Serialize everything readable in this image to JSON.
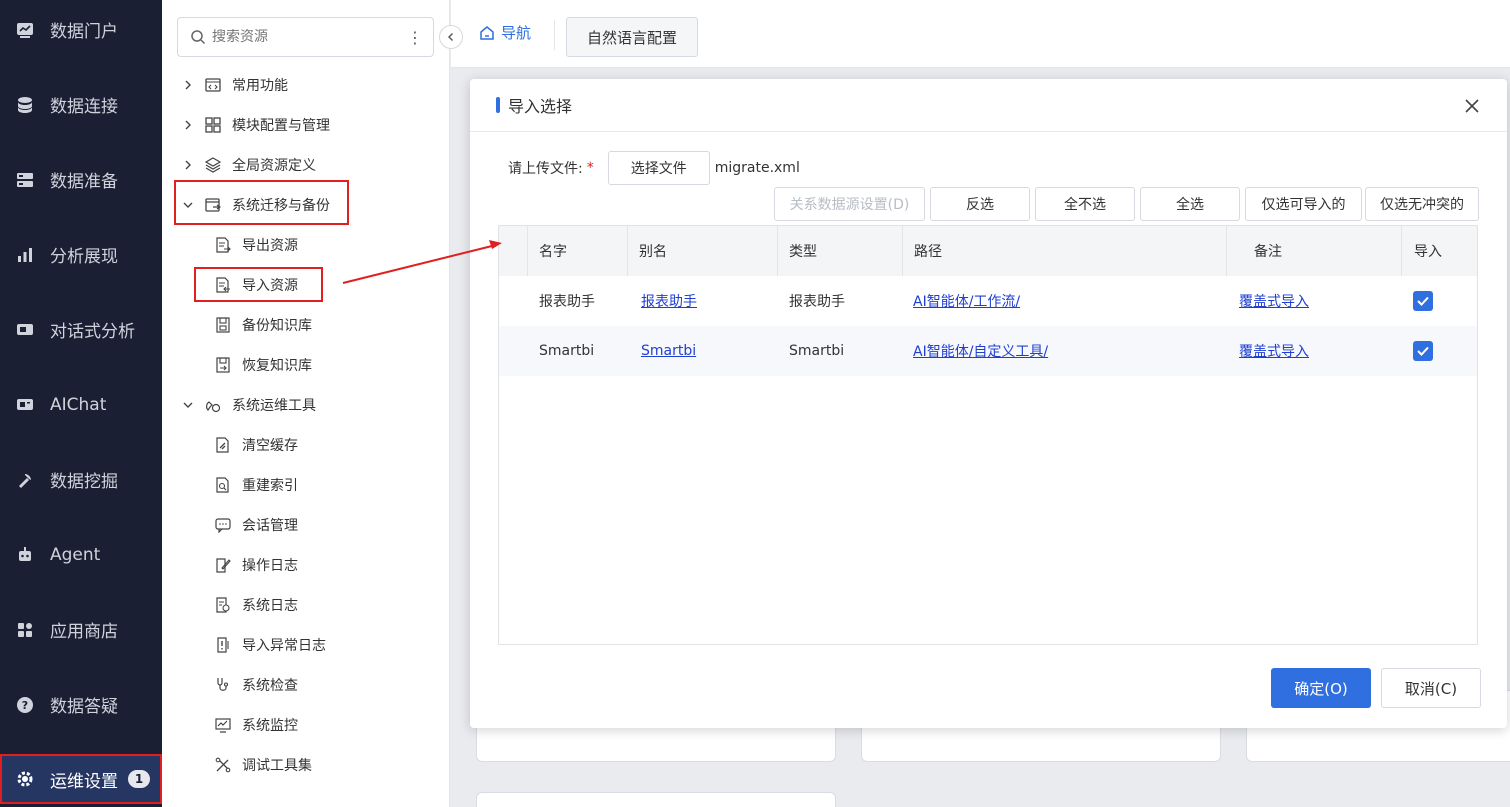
{
  "leftnav": {
    "items": [
      {
        "label": "数据门户",
        "icon": "portal-icon"
      },
      {
        "label": "数据连接",
        "icon": "database-icon"
      },
      {
        "label": "数据准备",
        "icon": "server-icon"
      },
      {
        "label": "分析展现",
        "icon": "bar-chart-icon"
      },
      {
        "label": "对话式分析",
        "icon": "chat-analysis-icon"
      },
      {
        "label": "AIChat",
        "icon": "ai-chat-icon"
      },
      {
        "label": "数据挖掘",
        "icon": "pickaxe-icon"
      },
      {
        "label": "Agent",
        "icon": "robot-icon"
      },
      {
        "label": "应用商店",
        "icon": "app-store-icon"
      },
      {
        "label": "数据答疑",
        "icon": "question-icon"
      },
      {
        "label": "运维设置",
        "icon": "gear-icon",
        "badge": "1"
      }
    ]
  },
  "tree": {
    "search_placeholder": "搜索资源",
    "items": [
      {
        "label": "常用功能",
        "icon": "code-window-icon"
      },
      {
        "label": "模块配置与管理",
        "icon": "grid-icon"
      },
      {
        "label": "全局资源定义",
        "icon": "layers-icon"
      },
      {
        "label": "系统迁移与备份",
        "icon": "migrate-icon"
      },
      {
        "label": "导出资源",
        "icon": "export-doc-icon"
      },
      {
        "label": "导入资源",
        "icon": "import-doc-icon"
      },
      {
        "label": "备份知识库",
        "icon": "backup-icon"
      },
      {
        "label": "恢复知识库",
        "icon": "restore-icon"
      },
      {
        "label": "系统运维工具",
        "icon": "ops-tools-icon"
      },
      {
        "label": "清空缓存",
        "icon": "clear-cache-icon"
      },
      {
        "label": "重建索引",
        "icon": "rebuild-index-icon"
      },
      {
        "label": "会话管理",
        "icon": "session-icon"
      },
      {
        "label": "操作日志",
        "icon": "edit-log-icon"
      },
      {
        "label": "系统日志",
        "icon": "system-log-icon"
      },
      {
        "label": "导入异常日志",
        "icon": "import-error-log-icon"
      },
      {
        "label": "系统检查",
        "icon": "stethoscope-icon"
      },
      {
        "label": "系统监控",
        "icon": "monitor-icon"
      },
      {
        "label": "调试工具集",
        "icon": "tools-icon"
      }
    ]
  },
  "topbar": {
    "home_label": "导航",
    "nlp_config_label": "自然语言配置"
  },
  "modal": {
    "title": "导入选择",
    "upload_label": "请上传文件:",
    "required_mark": "*",
    "choose_file_label": "选择文件",
    "file_name": "migrate.xml",
    "buttons": {
      "relation_ds": "关系数据源设置(D)",
      "invert": "反选",
      "select_none": "全不选",
      "select_all": "全选",
      "importable_only": "仅选可导入的",
      "no_conflict_only": "仅选无冲突的"
    },
    "columns": [
      "名字",
      "别名",
      "类型",
      "路径",
      "备注",
      "导入"
    ],
    "rows": [
      {
        "name": "报表助手",
        "alias": "报表助手",
        "type": "报表助手",
        "path": "AI智能体/工作流/",
        "note": "覆盖式导入",
        "checked": true
      },
      {
        "name": "Smartbi",
        "alias": "Smartbi",
        "type": "Smartbi",
        "path": "AI智能体/自定义工具/",
        "note": "覆盖式导入",
        "checked": true
      }
    ],
    "ok_label": "确定(O)",
    "cancel_label": "取消(C)"
  },
  "colors": {
    "accent": "#2f6fe0",
    "nav_bg": "#1b1f33",
    "highlight": "#e02020"
  }
}
